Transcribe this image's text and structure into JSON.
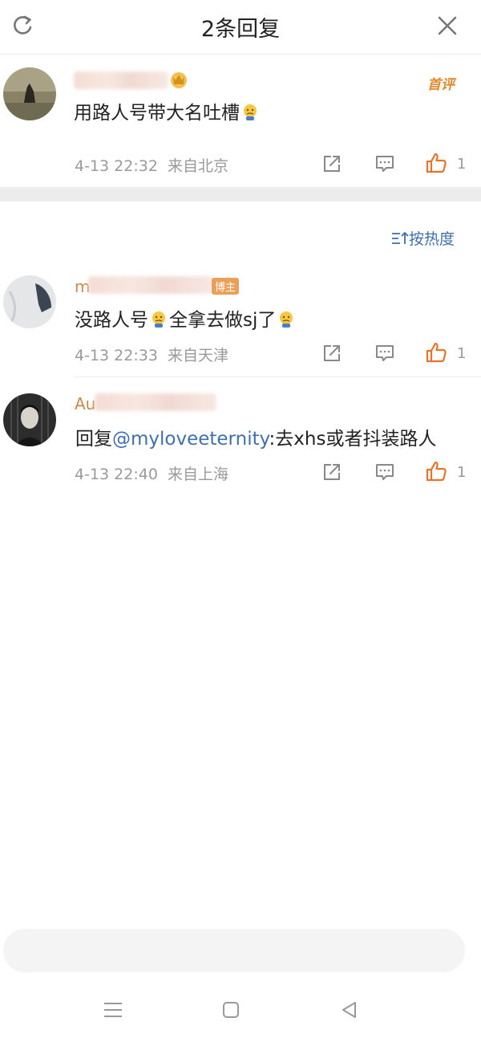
{
  "header": {
    "title": "2条回复"
  },
  "main_comment": {
    "content": "用路人号带大名吐槽",
    "first_tag": "首评",
    "time": "4-13 22:32",
    "location": "来自北京",
    "likes": "1"
  },
  "sort": {
    "label": "按热度"
  },
  "replies": [
    {
      "name_prefix": "m",
      "badge": "博主",
      "content_a": "没路人号",
      "content_b": "全拿去做sj了",
      "time": "4-13 22:33",
      "location": "来自天津",
      "likes": "1"
    },
    {
      "name_prefix": "Au",
      "content_prefix": "回复",
      "mention": "@myloveeternity",
      "content_suffix": ":去xhs或者抖装路人",
      "time": "4-13 22:40",
      "location": "来自上海",
      "likes": "1"
    }
  ],
  "colors": {
    "accent": "#3f6fae",
    "like": "#e8742a",
    "first_tag": "#e08a2c"
  }
}
